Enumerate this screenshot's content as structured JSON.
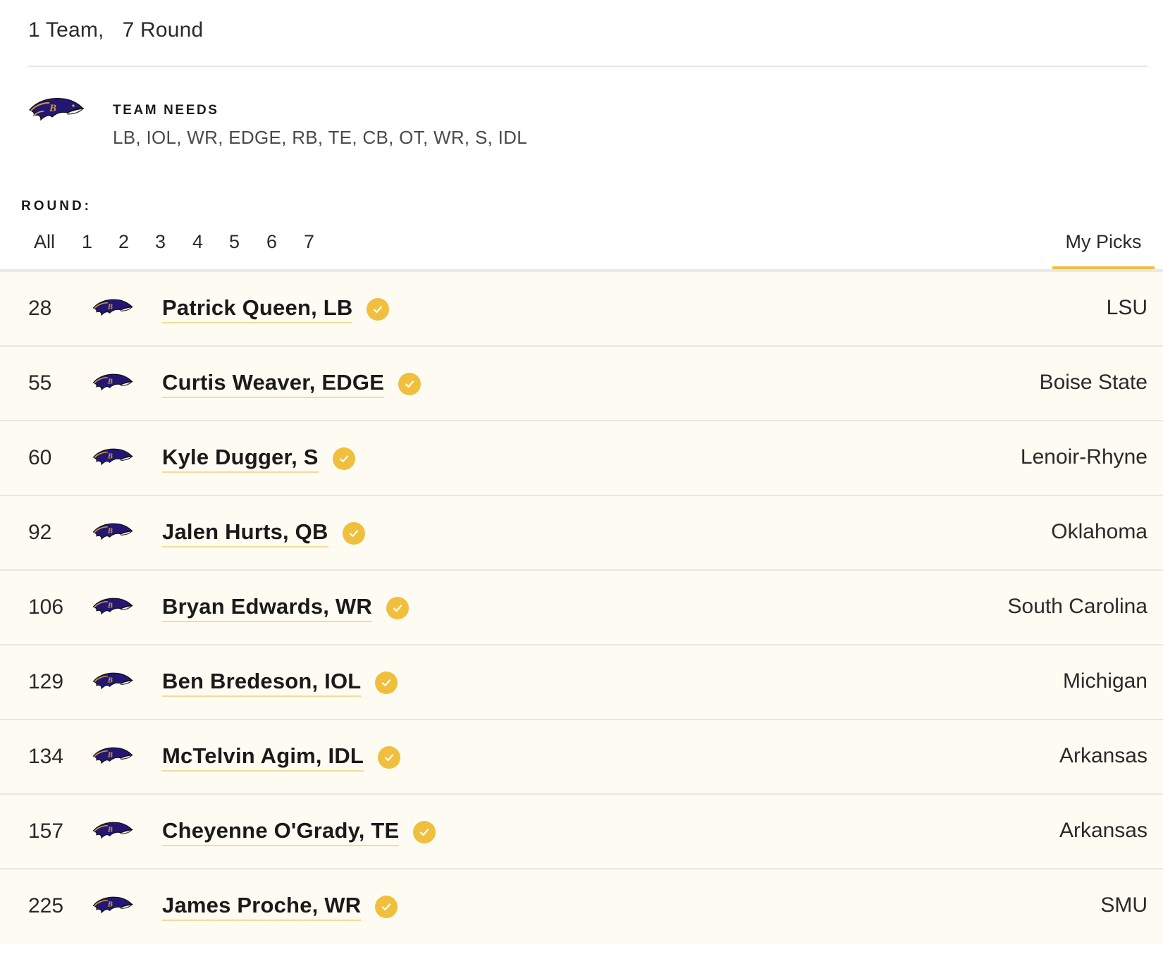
{
  "summary": {
    "teams": "1 Team,",
    "rounds": "7 Round"
  },
  "team_needs": {
    "title": "TEAM NEEDS",
    "list": "LB, IOL, WR, EDGE, RB, TE, CB, OT, WR, S, IDL",
    "logo_icon": "ravens-logo-icon"
  },
  "round_filter": {
    "label": "ROUND:",
    "tabs": [
      "All",
      "1",
      "2",
      "3",
      "4",
      "5",
      "6",
      "7"
    ],
    "my_picks": "My Picks",
    "active": "My Picks"
  },
  "colors": {
    "accent": "#f0bf3d",
    "row_background": "#fefbf2",
    "ravens_purple": "#241773",
    "ravens_gold": "#9e7c0c"
  },
  "picks": [
    {
      "number": "28",
      "player": "Patrick Queen, LB",
      "school": "LSU"
    },
    {
      "number": "55",
      "player": "Curtis Weaver, EDGE",
      "school": "Boise State"
    },
    {
      "number": "60",
      "player": "Kyle Dugger, S",
      "school": "Lenoir-Rhyne"
    },
    {
      "number": "92",
      "player": "Jalen Hurts, QB",
      "school": "Oklahoma"
    },
    {
      "number": "106",
      "player": "Bryan Edwards, WR",
      "school": "South Carolina"
    },
    {
      "number": "129",
      "player": "Ben Bredeson, IOL",
      "school": "Michigan"
    },
    {
      "number": "134",
      "player": "McTelvin Agim, IDL",
      "school": "Arkansas"
    },
    {
      "number": "157",
      "player": "Cheyenne O'Grady, TE",
      "school": "Arkansas"
    },
    {
      "number": "225",
      "player": "James Proche, WR",
      "school": "SMU"
    }
  ]
}
